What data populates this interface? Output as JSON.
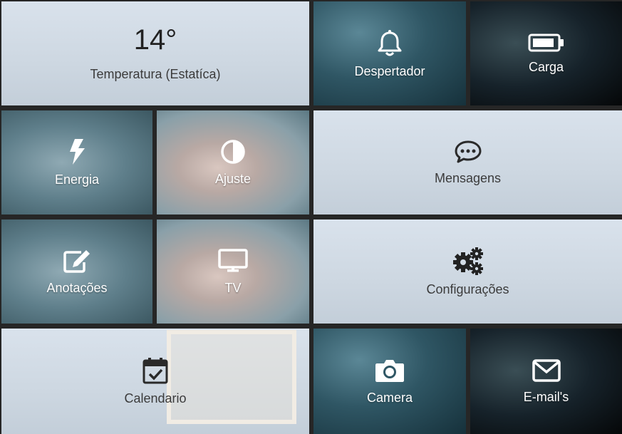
{
  "tiles": {
    "temperature": {
      "value": "14°",
      "label": "Temperatura (Estatíca)"
    },
    "alarm": {
      "label": "Despertador",
      "icon": "bell-icon"
    },
    "battery": {
      "label": "Carga",
      "icon": "battery-icon"
    },
    "energy": {
      "label": "Energia",
      "icon": "bolt-icon"
    },
    "adjust": {
      "label": "Ajuste",
      "icon": "contrast-icon"
    },
    "messages": {
      "label": "Mensagens",
      "icon": "chat-icon"
    },
    "notes": {
      "label": "Anotações",
      "icon": "edit-icon"
    },
    "tv": {
      "label": "TV",
      "icon": "tv-icon"
    },
    "settings": {
      "label": "Configurações",
      "icon": "cogs-icon"
    },
    "calendar": {
      "label": "Calendario",
      "icon": "calendar-check-icon"
    },
    "camera": {
      "label": "Camera",
      "icon": "camera-icon"
    },
    "email": {
      "label": "E-mail's",
      "icon": "envelope-icon"
    }
  },
  "colors": {
    "gap": "#262626",
    "light_tile": "#d4dde6",
    "dark_tile": "#1f3a44",
    "text_dark": "#333333",
    "text_light": "#ffffff"
  }
}
